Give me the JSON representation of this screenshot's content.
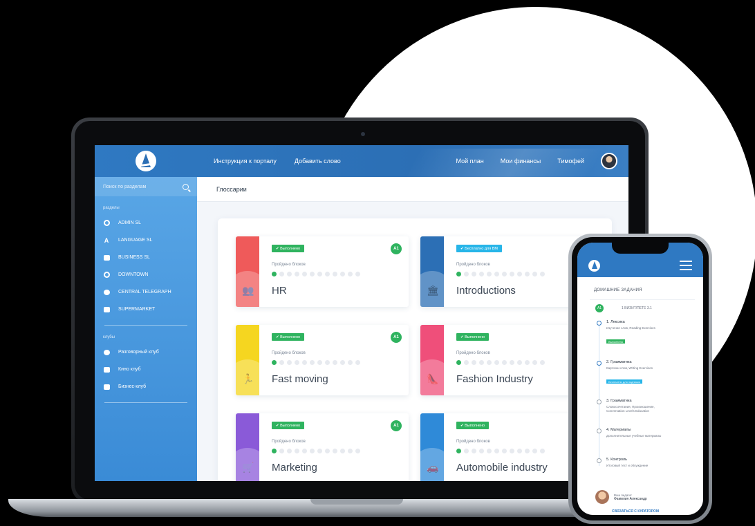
{
  "header": {
    "nav_left": [
      "Инструкция к порталу",
      "Добавить слово"
    ],
    "nav_right": [
      "Мой план",
      "Мои финансы",
      "Тимофей"
    ]
  },
  "sidebar": {
    "search_placeholder": "Поиск по разделам",
    "sections_label": "разделы",
    "sections": [
      {
        "label": "ADMIN SL",
        "icon": "circle-icon"
      },
      {
        "label": "LANGUAGE SL",
        "icon": "letter-a-icon"
      },
      {
        "label": "BUSINESS SL",
        "icon": "briefcase-icon"
      },
      {
        "label": "DOWNTOWN",
        "icon": "clock-icon"
      },
      {
        "label": "CENTRAL TELEGRAPH",
        "icon": "chat-icon"
      },
      {
        "label": "SUPERMARKET",
        "icon": "basket-icon"
      }
    ],
    "clubs_label": "клубы",
    "clubs": [
      {
        "label": "Разговорный клуб",
        "icon": "speech-icon"
      },
      {
        "label": "Кино клуб",
        "icon": "camera-icon"
      },
      {
        "label": "Бизнес-клуб",
        "icon": "group-icon"
      }
    ]
  },
  "main": {
    "page_title": "Глоссарии",
    "cards": [
      {
        "title": "HR",
        "badge": "Выполнено",
        "badge_type": "green",
        "level": "A1",
        "progress_label": "Пройдено блоков",
        "done_dots": 1,
        "total_dots": 12,
        "color": "#ef5a5a",
        "icon": "people-icon"
      },
      {
        "title": "Introductions",
        "badge": "Бесплатно для ВМ",
        "badge_type": "cyan",
        "level": "",
        "progress_label": "Пройдено блоков",
        "done_dots": 1,
        "total_dots": 12,
        "color": "#2c6fb5",
        "icon": "bank-icon"
      },
      {
        "title": "Fast moving",
        "badge": "Выполнено",
        "badge_type": "green",
        "level": "A1",
        "progress_label": "Пройдено блоков",
        "done_dots": 1,
        "total_dots": 12,
        "color": "#f5d620",
        "icon": "runner-icon"
      },
      {
        "title": "Fashion Industry",
        "badge": "Выполнено",
        "badge_type": "green",
        "level": "",
        "progress_label": "Пройдено блоков",
        "done_dots": 1,
        "total_dots": 12,
        "color": "#ef4f7a",
        "icon": "shoe-icon"
      },
      {
        "title": "Marketing",
        "badge": "Выполнено",
        "badge_type": "green",
        "level": "A1",
        "progress_label": "Пройдено блоков",
        "done_dots": 1,
        "total_dots": 12,
        "color": "#8a5ad8",
        "icon": "cart-icon"
      },
      {
        "title": "Automobile industry",
        "badge": "Выполнено",
        "badge_type": "green",
        "level": "",
        "progress_label": "Пройдено блоков",
        "done_dots": 1,
        "total_dots": 12,
        "color": "#2f8ad8",
        "icon": "car-icon"
      }
    ]
  },
  "phone": {
    "homework_title": "ДОМАШНИЕ ЗАДАНИЯ",
    "hw_number": "A1",
    "hw_subtitle": "1 ВИЗИТ/ПЕТЕ 3.1",
    "steps": [
      {
        "title": "1. Лексика",
        "text": "Изучение слов, Reading Exercises",
        "tag": "Выполнено",
        "tag_type": "green"
      },
      {
        "title": "2. Грамматика",
        "text": "Карточки слов, Writing Exercises",
        "tag": "Бесплатно для подписки",
        "tag_type": "cyan"
      },
      {
        "title": "3. Грамматика",
        "text": "Словосочетания, Произношение, Conversation Levels Education",
        "tag": "",
        "tag_type": ""
      },
      {
        "title": "4. Материалы",
        "text": "Дополнительные учебные материалы",
        "tag": "",
        "tag_type": ""
      },
      {
        "title": "5. Контроль",
        "text": "Итоговый тест и обсуждение",
        "tag": "",
        "tag_type": ""
      }
    ],
    "teacher_role": "Ваш педагог",
    "teacher_name": "Фамилия Александр",
    "contact_link": "СВЯЗАТЬСЯ С КУРАТОРОМ"
  }
}
